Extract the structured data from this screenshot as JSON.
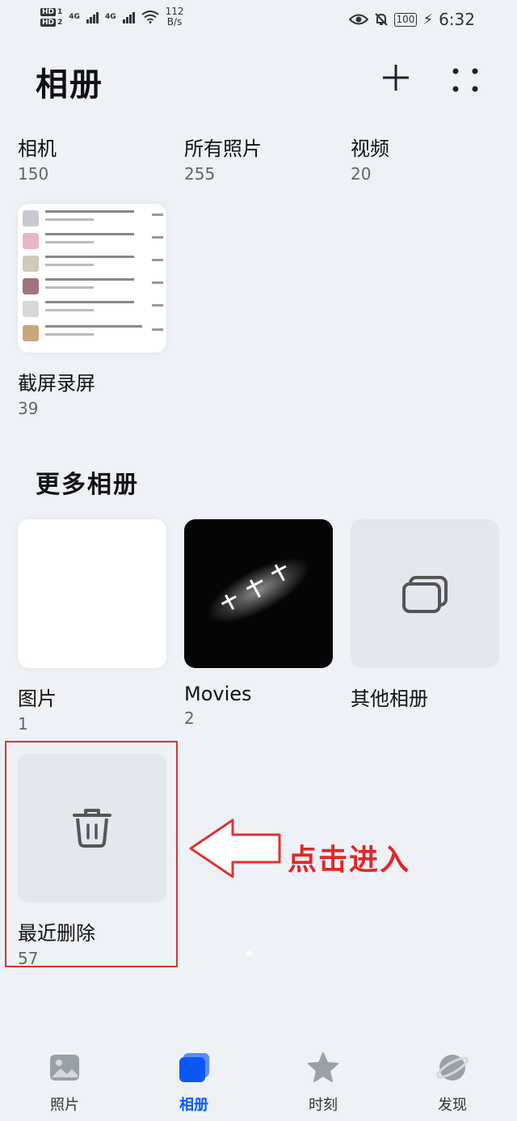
{
  "status_bar": {
    "hd1": "HD",
    "hd1_num": "1",
    "hd2": "HD",
    "hd2_num": "2",
    "net1": "4G",
    "net2": "4G",
    "speed_value": "112",
    "speed_unit": "B/s",
    "battery": "100",
    "time": "6:32"
  },
  "header": {
    "title": "相册"
  },
  "albums": [
    {
      "name": "相机",
      "count": "150"
    },
    {
      "name": "所有照片",
      "count": "255"
    },
    {
      "name": "视频",
      "count": "20"
    },
    {
      "name": "截屏录屏",
      "count": "39"
    }
  ],
  "more_section": {
    "title": "更多相册",
    "albums": [
      {
        "name": "图片",
        "count": "1"
      },
      {
        "name": "Movies",
        "count": "2"
      },
      {
        "name": "其他相册",
        "count": ""
      },
      {
        "name": "最近删除",
        "count": "57"
      }
    ]
  },
  "annotation": {
    "text": "点击进入"
  },
  "bottom_nav": [
    {
      "label": "照片",
      "icon": "photo-icon"
    },
    {
      "label": "相册",
      "icon": "album-icon",
      "active": true
    },
    {
      "label": "时刻",
      "icon": "star-icon"
    },
    {
      "label": "发现",
      "icon": "planet-icon"
    }
  ],
  "colors": {
    "accent": "#0a59f7",
    "annotation_red": "#e02828",
    "background": "#eef1f6"
  }
}
